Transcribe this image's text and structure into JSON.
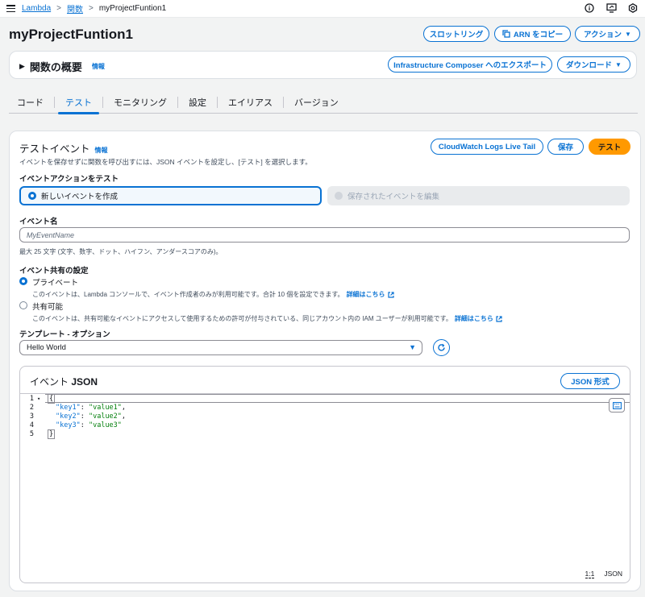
{
  "breadcrumb": {
    "items": [
      "Lambda",
      "関数",
      "myProjectFuntion1"
    ]
  },
  "header": {
    "title": "myProjectFuntion1",
    "buttons": {
      "throttle": "スロットリング",
      "copy_arn": "ARN をコピー",
      "actions": "アクション"
    }
  },
  "overview": {
    "title": "関数の概要",
    "info": "情報",
    "export_button": "Infrastructure Composer へのエクスポート",
    "download_button": "ダウンロード"
  },
  "tabs": [
    "コード",
    "テスト",
    "モニタリング",
    "設定",
    "エイリアス",
    "バージョン"
  ],
  "test_event": {
    "title": "テストイベント",
    "info": "情報",
    "description": "イベントを保存せずに関数を呼び出すには、JSON イベントを設定し、[テスト] を選択します。",
    "buttons": {
      "live_tail": "CloudWatch Logs Live Tail",
      "save": "保存",
      "test": "テスト"
    },
    "action_label": "イベントアクションをテスト",
    "action_new": "新しいイベントを作成",
    "action_edit": "保存されたイベントを編集",
    "name_label": "イベント名",
    "name_placeholder": "MyEventName",
    "name_hint": "最大 25 文字 (文字、数字、ドット、ハイフン、アンダースコアのみ)。",
    "sharing_label": "イベント共有の設定",
    "private_title": "プライベート",
    "private_desc": "このイベントは、Lambda コンソールで、イベント作成者のみが利用可能です。合計 10 個を設定できます。",
    "shared_title": "共有可能",
    "shared_desc": "このイベントは、共有可能なイベントにアクセスして使用するための許可が付与されている、同じアカウント内の IAM ユーザーが利用可能です。",
    "more_link": "詳細はこちら",
    "template_label": "テンプレート - オプション",
    "template_value": "Hello World"
  },
  "json_editor": {
    "title_prefix": "イベント",
    "title_json": "JSON",
    "format_button": "JSON 形式",
    "lines": [
      {
        "n": "1",
        "fold": "▾",
        "text": "{"
      },
      {
        "n": "2",
        "key": "\"key1\"",
        "value": "\"value1\"",
        "comma": ","
      },
      {
        "n": "3",
        "key": "\"key2\"",
        "value": "\"value2\"",
        "comma": ","
      },
      {
        "n": "4",
        "key": "\"key3\"",
        "value": "\"value3\"",
        "comma": ""
      },
      {
        "n": "5",
        "text": "}"
      }
    ],
    "cursor_position": "1:1",
    "language": "JSON"
  },
  "colors": {
    "link": "#0972d3",
    "primary": "#ff9900",
    "string": "#037f0c"
  }
}
